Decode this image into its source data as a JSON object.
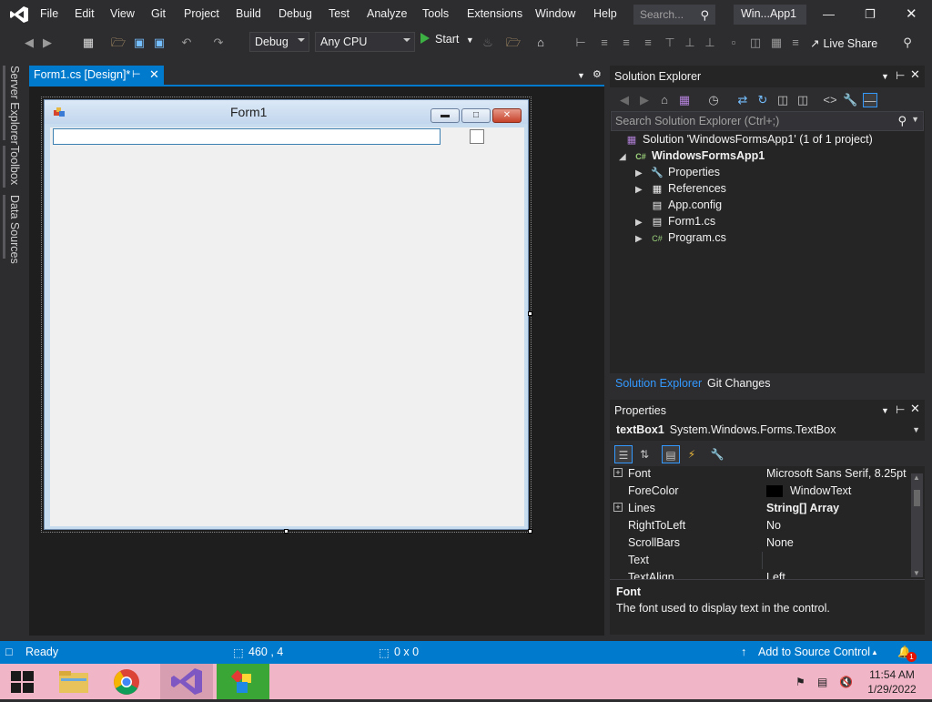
{
  "menubar": {
    "items": [
      "File",
      "Edit",
      "View",
      "Git",
      "Project",
      "Build",
      "Debug",
      "Test",
      "Analyze",
      "Tools",
      "Extensions",
      "Window",
      "Help"
    ],
    "search_placeholder": "Search...",
    "window_title": "Win...App1"
  },
  "toolbar": {
    "config": "Debug",
    "platform": "Any CPU",
    "start_label": "Start",
    "live_share_label": "Live Share"
  },
  "side_tabs": [
    "Server Explorer",
    "Toolbox",
    "Data Sources"
  ],
  "document": {
    "tab_label": "Form1.cs [Design]*",
    "form_title": "Form1"
  },
  "solution_explorer": {
    "title": "Solution Explorer",
    "search_placeholder": "Search Solution Explorer (Ctrl+;)",
    "tree": [
      {
        "label": "Solution 'WindowsFormsApp1' (1 of 1 project)",
        "icon": "solution-icon"
      },
      {
        "label": "WindowsFormsApp1",
        "icon": "csharp-project-icon"
      },
      {
        "label": "Properties",
        "icon": "wrench-icon"
      },
      {
        "label": "References",
        "icon": "references-icon"
      },
      {
        "label": "App.config",
        "icon": "config-file-icon"
      },
      {
        "label": "Form1.cs",
        "icon": "form-file-icon"
      },
      {
        "label": "Program.cs",
        "icon": "csharp-file-icon"
      }
    ],
    "tabs": [
      "Solution Explorer",
      "Git Changes"
    ]
  },
  "properties": {
    "title": "Properties",
    "object_name": "textBox1",
    "object_type": "System.Windows.Forms.TextBox",
    "rows": [
      {
        "name": "Font",
        "value": "Microsoft Sans Serif, 8.25pt"
      },
      {
        "name": "ForeColor",
        "value": "WindowText"
      },
      {
        "name": "Lines",
        "value": "String[] Array"
      },
      {
        "name": "RightToLeft",
        "value": "No"
      },
      {
        "name": "ScrollBars",
        "value": "None"
      },
      {
        "name": "Text",
        "value": ""
      },
      {
        "name": "TextAlign",
        "value": "Left"
      }
    ],
    "desc_title": "Font",
    "desc_text": "The font used to display text in the control."
  },
  "statusbar": {
    "ready": "Ready",
    "position": "460 , 4",
    "size": "0 x 0",
    "source_control": "Add to Source Control",
    "notification_count": "1"
  },
  "taskbar": {
    "time": "11:54 AM",
    "date": "1/29/2022"
  },
  "colors": {
    "accent": "#007acc",
    "taskbar": "#f0b6c8"
  }
}
